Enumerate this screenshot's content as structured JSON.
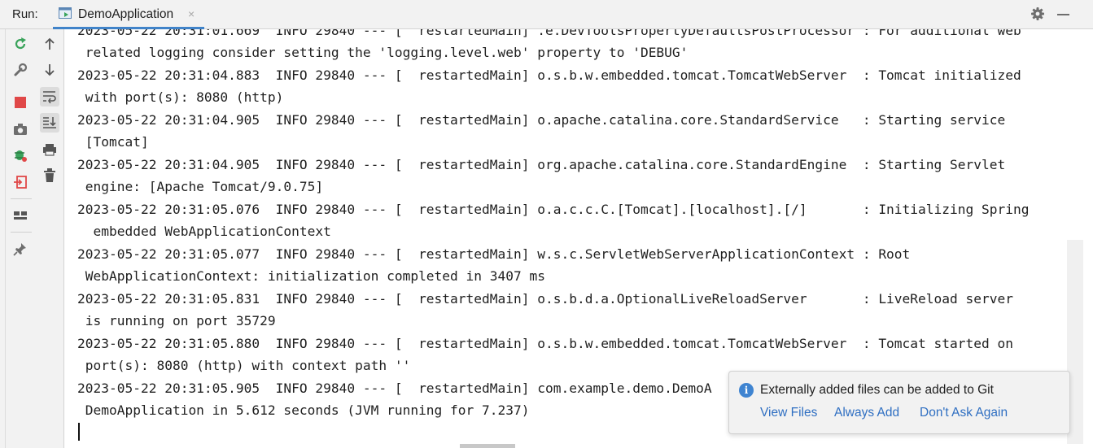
{
  "run_panel": {
    "label": "Run:",
    "tab_title": "DemoApplication",
    "tab_close": "×"
  },
  "toolbar": {
    "buttons": [
      "rerun-icon",
      "up-arrow-icon",
      "down-arrow-icon",
      "wrench-icon",
      "soft-wrap-icon",
      "stop-icon",
      "scroll-to-end-icon",
      "camera-icon",
      "print-icon",
      "debug-icon",
      "trash-icon",
      "exit-icon",
      "layout-icon",
      "pin-icon"
    ]
  },
  "console": {
    "lines": [
      "2023-05-22 20:31:01.669  INFO 29840 --- [  restartedMain] .e.DevToolsPropertyDefaultsPostProcessor : For additional web",
      " related logging consider setting the 'logging.level.web' property to 'DEBUG'",
      "2023-05-22 20:31:04.883  INFO 29840 --- [  restartedMain] o.s.b.w.embedded.tomcat.TomcatWebServer  : Tomcat initialized",
      " with port(s): 8080 (http)",
      "2023-05-22 20:31:04.905  INFO 29840 --- [  restartedMain] o.apache.catalina.core.StandardService   : Starting service",
      " [Tomcat]",
      "2023-05-22 20:31:04.905  INFO 29840 --- [  restartedMain] org.apache.catalina.core.StandardEngine  : Starting Servlet",
      " engine: [Apache Tomcat/9.0.75]",
      "2023-05-22 20:31:05.076  INFO 29840 --- [  restartedMain] o.a.c.c.C.[Tomcat].[localhost].[/]       : Initializing Spring",
      "  embedded WebApplicationContext",
      "2023-05-22 20:31:05.077  INFO 29840 --- [  restartedMain] w.s.c.ServletWebServerApplicationContext : Root",
      " WebApplicationContext: initialization completed in 3407 ms",
      "2023-05-22 20:31:05.831  INFO 29840 --- [  restartedMain] o.s.b.d.a.OptionalLiveReloadServer       : LiveReload server",
      " is running on port 35729",
      "2023-05-22 20:31:05.880  INFO 29840 --- [  restartedMain] o.s.b.w.embedded.tomcat.TomcatWebServer  : Tomcat started on",
      " port(s): 8080 (http) with context path ''",
      "2023-05-22 20:31:05.905  INFO 29840 --- [  restartedMain] com.example.demo.DemoA",
      " DemoApplication in 5.612 seconds (JVM running for 7.237)"
    ]
  },
  "notification": {
    "message": "Externally added files can be added to Git",
    "actions": [
      "View Files",
      "Always Add",
      "Don't Ask Again"
    ]
  },
  "colors": {
    "accent": "#4083c9",
    "link": "#2f6fc2",
    "stop": "#e04848",
    "rerun": "#3aa35b"
  }
}
